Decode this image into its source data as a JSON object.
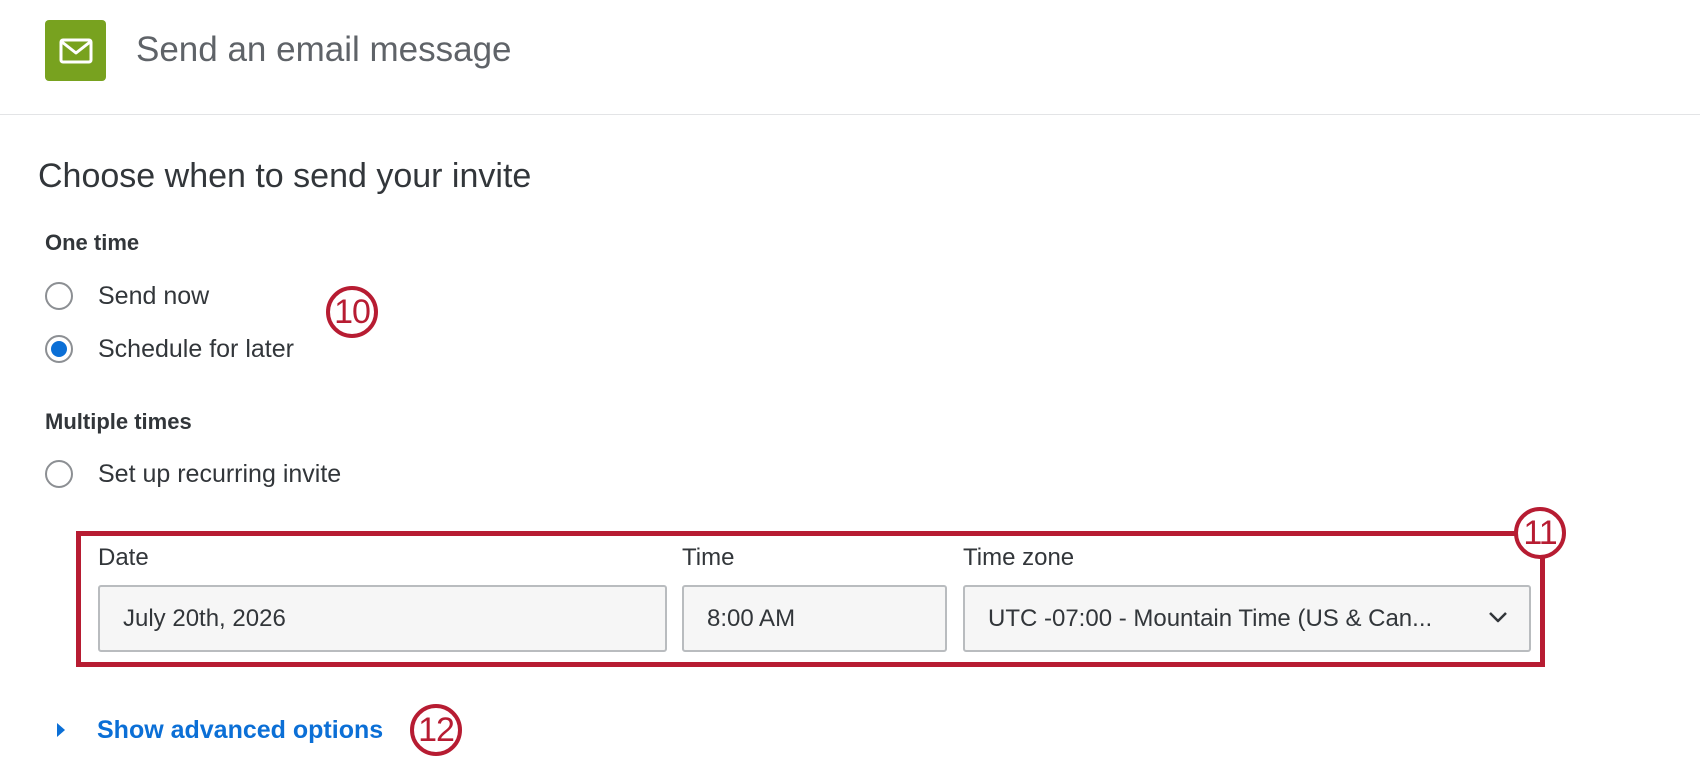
{
  "header": {
    "title": "Send an email message",
    "icon": "envelope-icon",
    "icon_color": "#78a21f"
  },
  "section": {
    "title": "Choose when to send your invite"
  },
  "one_time": {
    "label": "One time",
    "options": [
      {
        "label": "Send now",
        "checked": false
      },
      {
        "label": "Schedule for later",
        "checked": true
      }
    ]
  },
  "multiple_times": {
    "label": "Multiple times",
    "options": [
      {
        "label": "Set up recurring invite",
        "checked": false
      }
    ]
  },
  "schedule": {
    "date": {
      "label": "Date",
      "value": "July 20th, 2026"
    },
    "time": {
      "label": "Time",
      "value": "8:00 AM"
    },
    "timezone": {
      "label": "Time zone",
      "value": "UTC -07:00 - Mountain Time (US & Can..."
    }
  },
  "advanced": {
    "label": "Show advanced options"
  },
  "callouts": {
    "c10": "10",
    "c11": "11",
    "c12": "12",
    "color": "#b71c32"
  },
  "colors": {
    "accent": "#0b6fd6",
    "text": "#32363a"
  }
}
